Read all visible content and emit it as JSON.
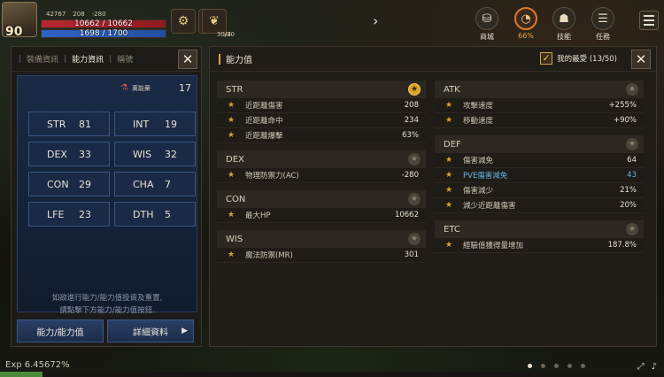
{
  "hud": {
    "level": "90",
    "stat_a": "42767",
    "stat_b": "208",
    "stat_c": "-280",
    "hp": "10662 / 10662",
    "mp": "1698 / 1700",
    "item1_count": "94",
    "item2_count": "30/30"
  },
  "menu": {
    "items": [
      {
        "label": "商城",
        "icon": "shop-bag-icon"
      },
      {
        "label": "66%",
        "icon": "gauge-icon"
      },
      {
        "label": "技能",
        "icon": "skill-icon"
      },
      {
        "label": "任務",
        "icon": "quest-scroll-icon"
      }
    ]
  },
  "left": {
    "tabs": [
      "裝備資訊",
      "能力資訊",
      "稱號"
    ],
    "active_tab": 1,
    "potion_label": "萬能藥",
    "potion_count": "17",
    "stats": [
      {
        "key": "STR",
        "val": "81"
      },
      {
        "key": "INT",
        "val": "19"
      },
      {
        "key": "DEX",
        "val": "33"
      },
      {
        "key": "WIS",
        "val": "32"
      },
      {
        "key": "CON",
        "val": "29"
      },
      {
        "key": "CHA",
        "val": "7"
      },
      {
        "key": "LFE",
        "val": "23"
      },
      {
        "key": "DTH",
        "val": "5"
      }
    ],
    "note_line1": "如欲進行能力/能力值投資及重置,",
    "note_line2": "請點擊下方能力/能力值按鈕.",
    "btn_ability": "能力/能力值",
    "btn_detail": "詳細資料"
  },
  "right": {
    "title": "能力值",
    "fav_label": "我的最愛 (13/50)",
    "groups_left": [
      {
        "name": "STR",
        "starred": true,
        "rows": [
          {
            "label": "近距離傷害",
            "value": "208"
          },
          {
            "label": "近距離命中",
            "value": "234"
          },
          {
            "label": "近距離爆擊",
            "value": "63%"
          }
        ]
      },
      {
        "name": "DEX",
        "starred": false,
        "rows": [
          {
            "label": "物理防禦力(AC)",
            "value": "-280"
          }
        ]
      },
      {
        "name": "CON",
        "starred": false,
        "rows": [
          {
            "label": "最大HP",
            "value": "10662"
          }
        ]
      },
      {
        "name": "WIS",
        "starred": false,
        "rows": [
          {
            "label": "魔法防禦(MR)",
            "value": "301"
          }
        ]
      }
    ],
    "groups_right": [
      {
        "name": "ATK",
        "starred": false,
        "rows": [
          {
            "label": "攻擊速度",
            "value": "+255%"
          },
          {
            "label": "移動速度",
            "value": "+90%"
          }
        ]
      },
      {
        "name": "DEF",
        "starred": false,
        "rows": [
          {
            "label": "傷害減免",
            "value": "64"
          },
          {
            "label": "PVE傷害減免",
            "value": "43",
            "highlight": true
          },
          {
            "label": "傷害減少",
            "value": "21%"
          },
          {
            "label": "減少近距離傷害",
            "value": "20%"
          }
        ]
      },
      {
        "name": "ETC",
        "starred": false,
        "rows": [
          {
            "label": "經驗值獲得量增加",
            "value": "187.8%"
          }
        ]
      }
    ]
  },
  "bottom": {
    "exp": "Exp 6.45672%",
    "exp_fraction": 0.064567
  },
  "colors": {
    "accent": "#e0a127",
    "highlight": "#5fb6e6",
    "hp": "#b7272f",
    "mp": "#2f63c6"
  }
}
